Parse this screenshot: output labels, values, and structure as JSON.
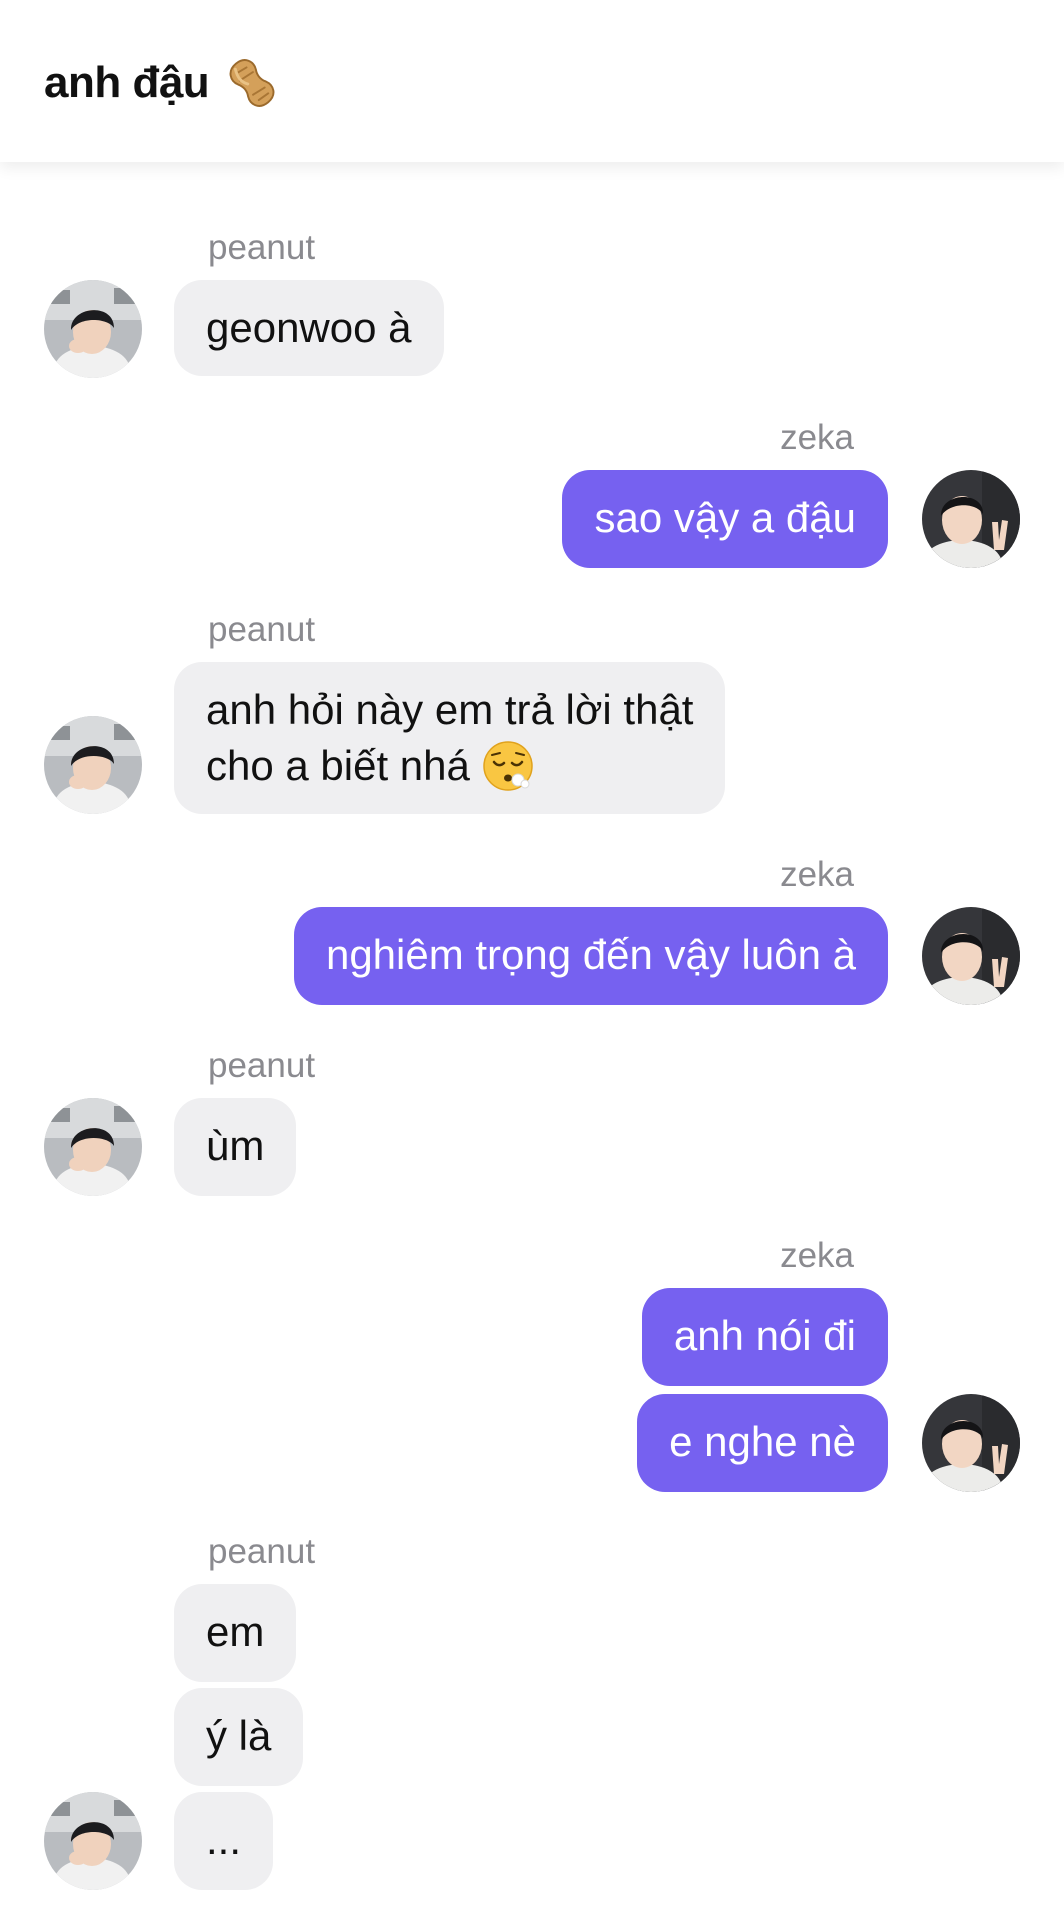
{
  "header": {
    "title": "anh đậu",
    "title_icon": "peanut-emoji"
  },
  "colors": {
    "outgoing_bubble": "#7661f0",
    "incoming_bubble": "#efeff1",
    "sender_label": "#8a8a8f"
  },
  "messages": [
    {
      "sender": "peanut",
      "side": "incoming",
      "text": "geonwoo à"
    },
    {
      "sender": "zeka",
      "side": "outgoing",
      "text": "sao vậy a đậu"
    },
    {
      "sender": "peanut",
      "side": "incoming",
      "line1": "anh hỏi này em trả lời thật",
      "line2": "cho a biết nhá",
      "emoji": "sighing-face-emoji"
    },
    {
      "sender": "zeka",
      "side": "outgoing",
      "text": "nghiêm trọng đến vậy luôn à"
    },
    {
      "sender": "peanut",
      "side": "incoming",
      "text": "ùm"
    },
    {
      "sender": "zeka",
      "side": "outgoing",
      "text": "anh nói đi"
    },
    {
      "sender": "zeka",
      "side": "outgoing",
      "text": "e nghe nè"
    },
    {
      "sender": "peanut",
      "side": "incoming",
      "text": "em"
    },
    {
      "sender": "peanut",
      "side": "incoming",
      "text": "ý là"
    },
    {
      "sender": "peanut",
      "side": "incoming",
      "text": "..."
    }
  ]
}
